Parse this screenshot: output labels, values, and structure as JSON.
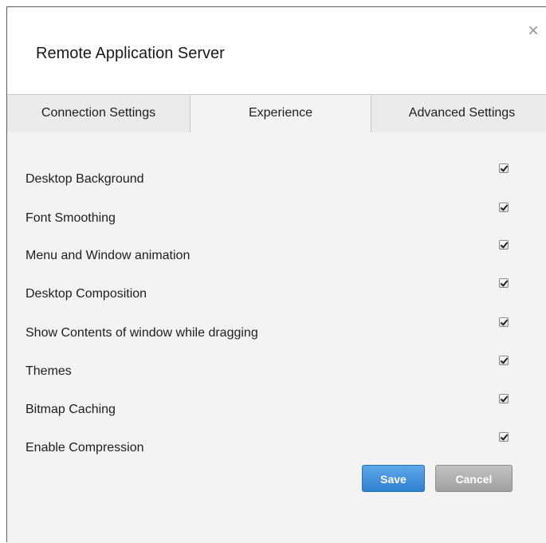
{
  "dialog": {
    "title": "Remote Application Server",
    "close_label": "×"
  },
  "tabs": [
    {
      "label": "Connection Settings",
      "active": false
    },
    {
      "label": "Experience",
      "active": true
    },
    {
      "label": "Advanced Settings",
      "active": false
    }
  ],
  "options": [
    {
      "label": "Desktop Background",
      "checked": true
    },
    {
      "label": "Font Smoothing",
      "checked": true
    },
    {
      "label": "Menu and Window animation",
      "checked": true
    },
    {
      "label": "Desktop Composition",
      "checked": true
    },
    {
      "label": "Show Contents of window while dragging",
      "checked": true
    },
    {
      "label": "Themes",
      "checked": true
    },
    {
      "label": "Bitmap Caching",
      "checked": true
    },
    {
      "label": "Enable Compression",
      "checked": true
    }
  ],
  "buttons": {
    "save_label": "Save",
    "cancel_label": "Cancel"
  }
}
